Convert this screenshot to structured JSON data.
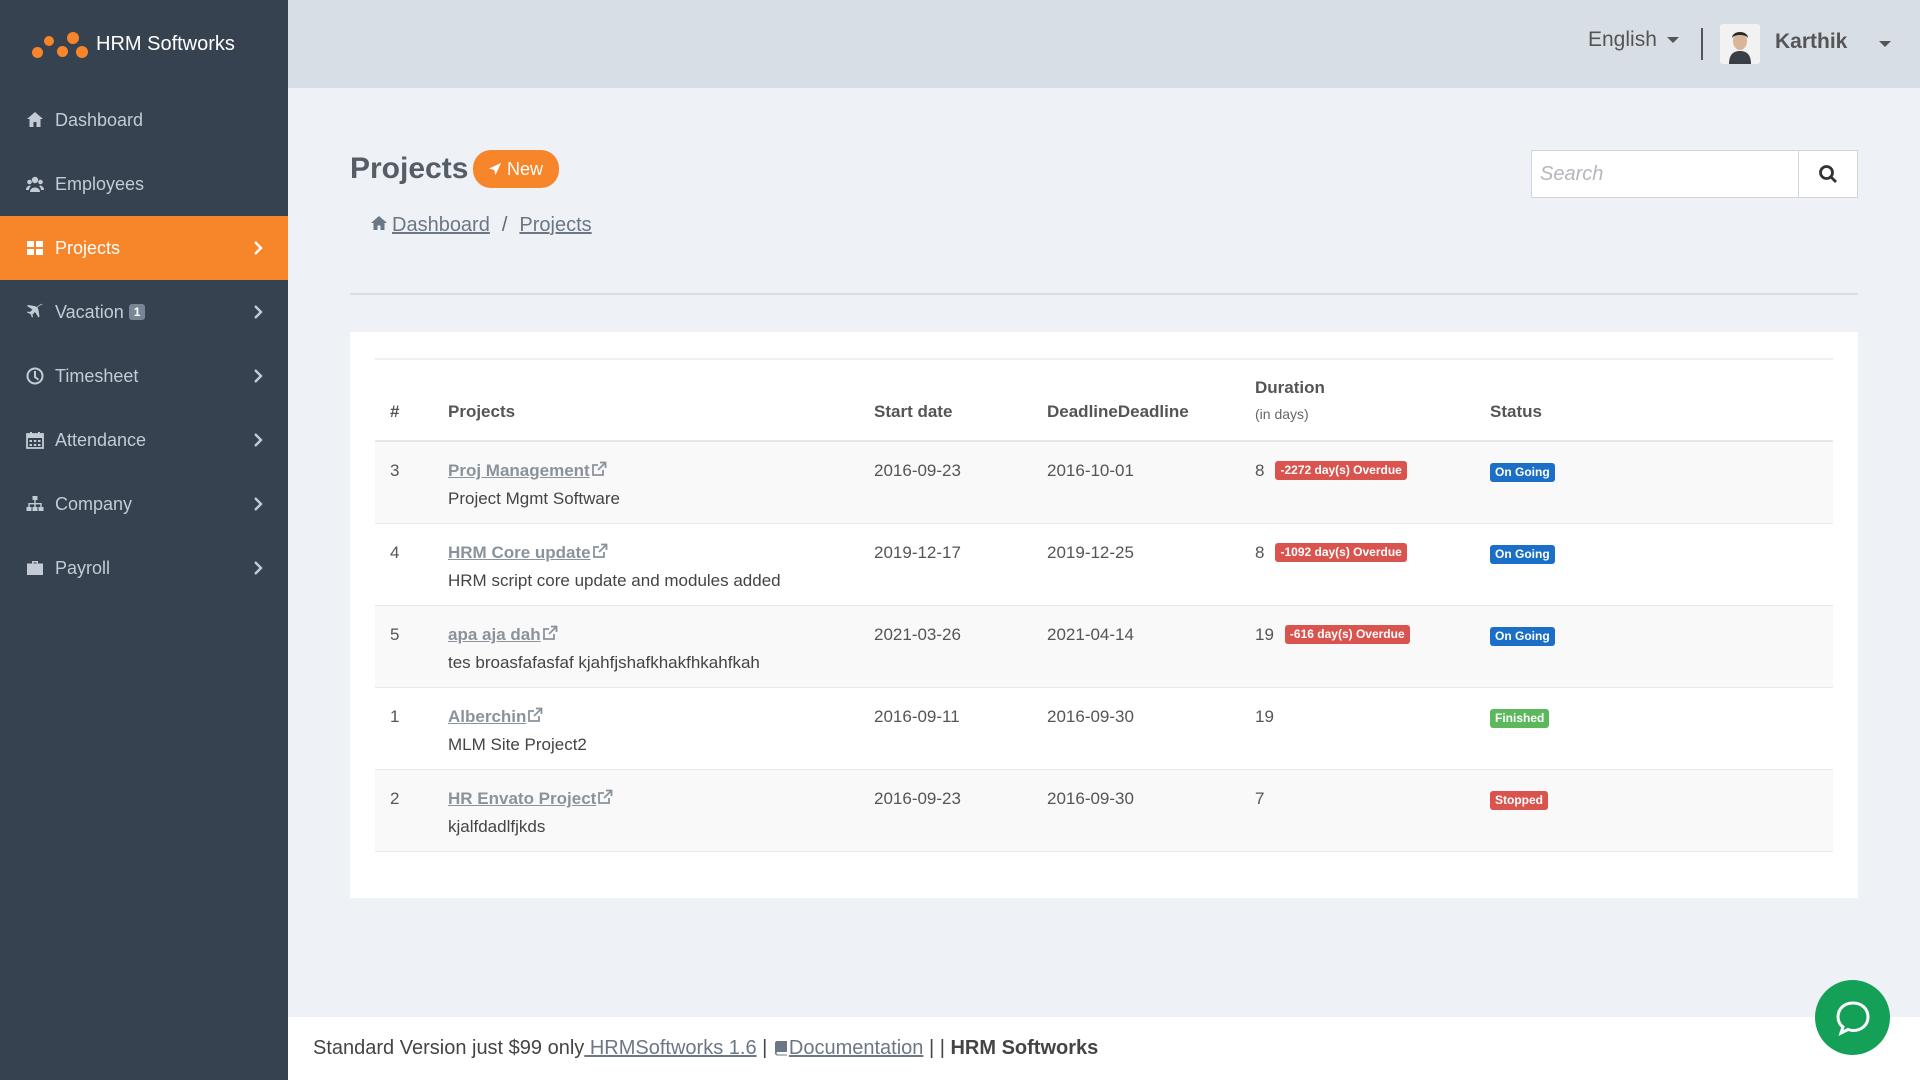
{
  "app": {
    "brand": "HRM Softworks",
    "accent_color": "#f7852a",
    "sidebar_color": "#374250"
  },
  "sidebar": {
    "items": [
      {
        "label": "Dashboard",
        "icon": "home-icon",
        "active": false,
        "has_chevron": false
      },
      {
        "label": "Employees",
        "icon": "users-icon",
        "active": false,
        "has_chevron": false
      },
      {
        "label": "Projects",
        "icon": "grid-icon",
        "active": true,
        "has_chevron": true
      },
      {
        "label": "Vacation",
        "icon": "plane-icon",
        "badge": "1",
        "active": false,
        "has_chevron": true
      },
      {
        "label": "Timesheet",
        "icon": "clock-icon",
        "active": false,
        "has_chevron": true
      },
      {
        "label": "Attendance",
        "icon": "calendar-icon",
        "active": false,
        "has_chevron": true
      },
      {
        "label": "Company",
        "icon": "sitemap-icon",
        "active": false,
        "has_chevron": true
      },
      {
        "label": "Payroll",
        "icon": "briefcase-icon",
        "active": false,
        "has_chevron": true
      }
    ]
  },
  "header": {
    "language": "English",
    "user_name": "Karthik"
  },
  "page": {
    "title": "Projects",
    "new_button": "New",
    "breadcrumb": [
      "Dashboard",
      "Projects"
    ],
    "breadcrumb_sep": "/",
    "search_placeholder": "Search"
  },
  "table": {
    "columns": {
      "num": "#",
      "projects": "Projects",
      "start": "Start date",
      "deadline": "DeadlineDeadline",
      "duration": "Duration",
      "duration_sub": "(in days)",
      "status": "Status"
    },
    "rows": [
      {
        "num": "3",
        "name": "Proj Management",
        "desc": "Project Mgmt Software",
        "start": "2016-09-23",
        "deadline": "2016-10-01",
        "duration": "8",
        "overdue": "-2272 day(s) Overdue",
        "status": "On Going",
        "status_color": "#1b6fc6"
      },
      {
        "num": "4",
        "name": "HRM Core update",
        "desc": "HRM script core update and modules added",
        "start": "2019-12-17",
        "deadline": "2019-12-25",
        "duration": "8",
        "overdue": "-1092 day(s) Overdue",
        "status": "On Going",
        "status_color": "#1b6fc6"
      },
      {
        "num": "5",
        "name": "apa aja dah",
        "desc": "tes broasfafasfaf kjahfjshafkhakfhkahfkah",
        "start": "2021-03-26",
        "deadline": "2021-04-14",
        "duration": "19",
        "overdue": "-616 day(s) Overdue",
        "status": "On Going",
        "status_color": "#1b6fc6"
      },
      {
        "num": "1",
        "name": "Alberchin",
        "desc": "MLM Site Project2",
        "start": "2016-09-11",
        "deadline": "2016-09-30",
        "duration": "19",
        "overdue": "",
        "status": "Finished",
        "status_color": "#5cb85c"
      },
      {
        "num": "2",
        "name": "HR Envato Project",
        "desc": "kjalfdadlfjkds",
        "start": "2016-09-23",
        "deadline": "2016-09-30",
        "duration": "7",
        "overdue": "",
        "status": "Stopped",
        "status_color": "#d9534f"
      }
    ]
  },
  "footer": {
    "text": "Standard Version just $99 only",
    "version_link": " HRMSoftworks 1.6",
    "pipe1": " | ",
    "doc_link": "Documentation",
    "pipe2": " | | ",
    "brand": "HRM Softworks"
  }
}
